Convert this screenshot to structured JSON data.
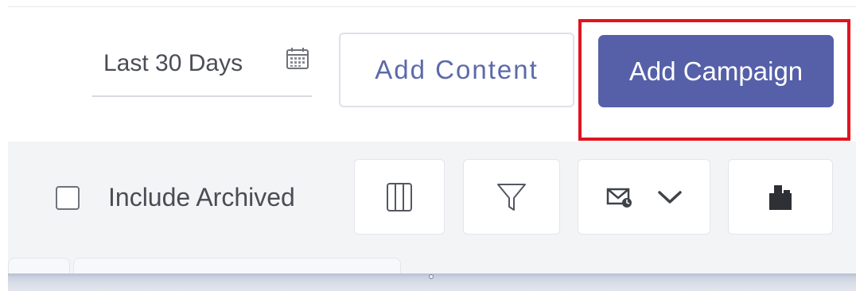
{
  "toolbar": {
    "date_range": "Last 30 Days",
    "calendar_icon": "calendar-icon",
    "add_content_label": "Add Content",
    "add_campaign_label": "Add Campaign"
  },
  "filter_bar": {
    "include_archived_label": "Include Archived",
    "include_archived_checked": false,
    "buttons": [
      {
        "icon": "columns-icon"
      },
      {
        "icon": "filter-icon"
      },
      {
        "icon": "email-icon",
        "dropdown_icon": "chevron-down-icon"
      },
      {
        "icon": "export-icon"
      }
    ]
  },
  "colors": {
    "primary": "#5560a8",
    "secondary_text": "#5c6aa8",
    "highlight": "#e0141f",
    "filter_bar_bg": "#f3f4f6"
  }
}
